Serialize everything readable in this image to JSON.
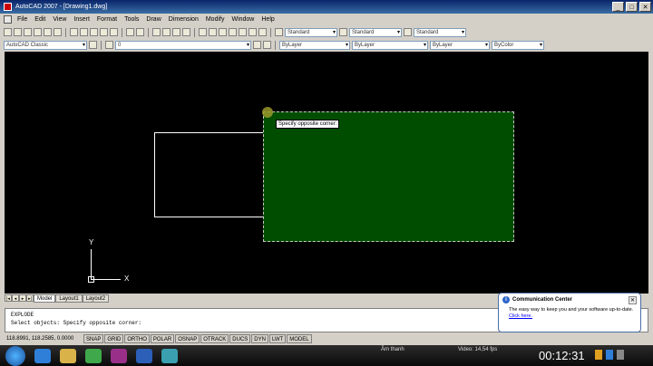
{
  "window": {
    "title": "AutoCAD 2007 - [Drawing1.dwg]",
    "min": "_",
    "max": "□",
    "close": "✕"
  },
  "menu": [
    "File",
    "Edit",
    "View",
    "Insert",
    "Format",
    "Tools",
    "Draw",
    "Dimension",
    "Modify",
    "Window",
    "Help"
  ],
  "toolbar": {
    "text_style": "Standard",
    "dim_style": "Standard",
    "table_style": "Standard",
    "workspace": "AutoCAD Classic",
    "layer": "0",
    "color": "ByLayer",
    "linetype": "ByLayer",
    "lineweight": "ByLayer",
    "plotstyle": "ByColor"
  },
  "canvas": {
    "tooltip": "Specify opposite corner:",
    "ucs_x": "X",
    "ucs_y": "Y"
  },
  "layout_tabs": [
    "Model",
    "Layout1",
    "Layout2"
  ],
  "command": {
    "line1": "EXPLODE",
    "line2": "Select objects: Specify opposite corner:"
  },
  "status": {
    "coords": "118.8991, 118.2585, 0.0000",
    "buttons": [
      "SNAP",
      "GRID",
      "ORTHO",
      "POLAR",
      "OSNAP",
      "OTRACK",
      "DUCS",
      "DYN",
      "LWT",
      "MODEL"
    ]
  },
  "notification": {
    "title": "Communication Center",
    "body": "The easy way to keep you and your software up-to-date.",
    "link": "Click here."
  },
  "taskbar": {
    "tray_label": "Âm thanh",
    "video_label": "Video: 14,54 fps",
    "clock": "00:12:31"
  },
  "colors": {
    "selection": "#004d00",
    "accent": "#0a246a"
  }
}
